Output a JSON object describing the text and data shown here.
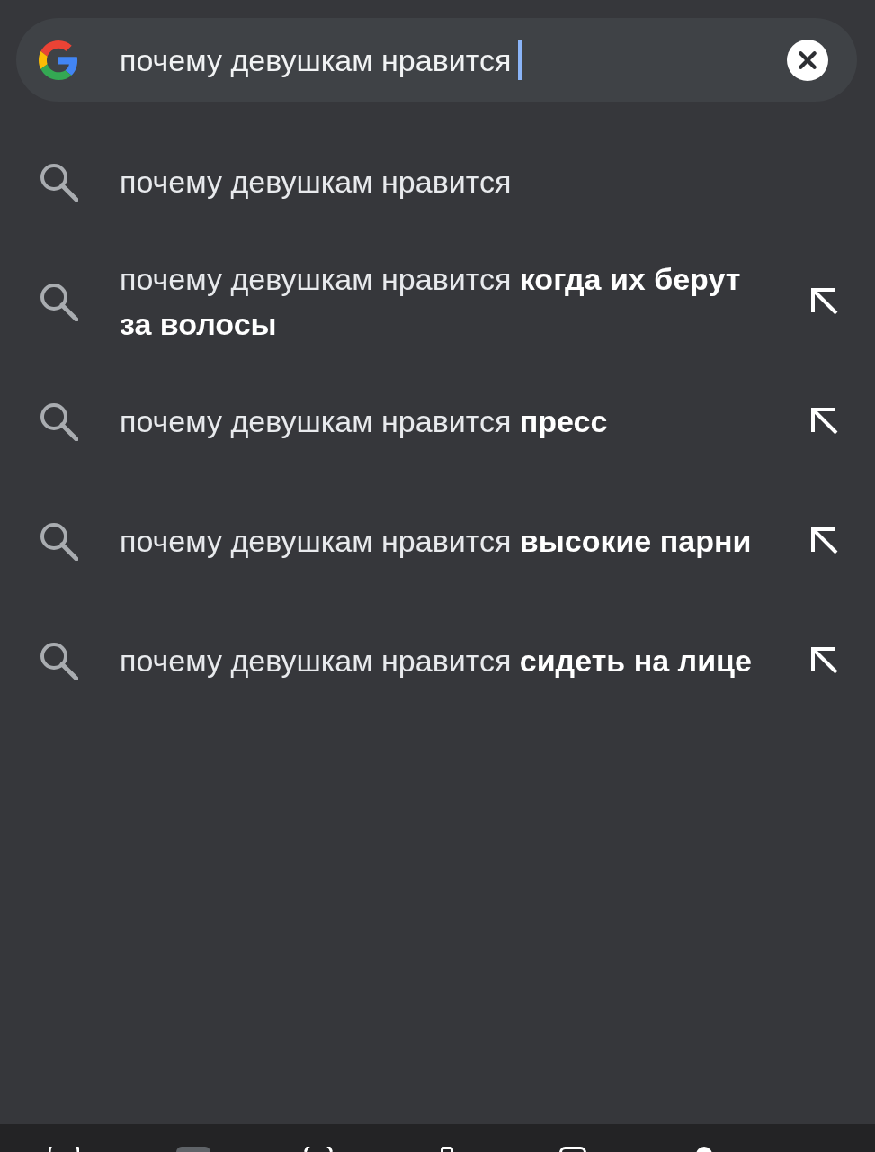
{
  "search_bar": {
    "value": "почему девушкам нравится"
  },
  "suggestions": [
    {
      "kind": "typed",
      "text": "почему девушкам нравится"
    },
    {
      "kind": "completion",
      "text": "почему девушкам нравится **когда их берут за волосы**"
    },
    {
      "kind": "completion",
      "text": "почему девушкам нравится **пресс**"
    },
    {
      "kind": "completion",
      "text": "почему девушкам нравится **высокие парни**"
    },
    {
      "kind": "completion",
      "text": "почему девушкам нравится **сидеть на лице**"
    }
  ]
}
